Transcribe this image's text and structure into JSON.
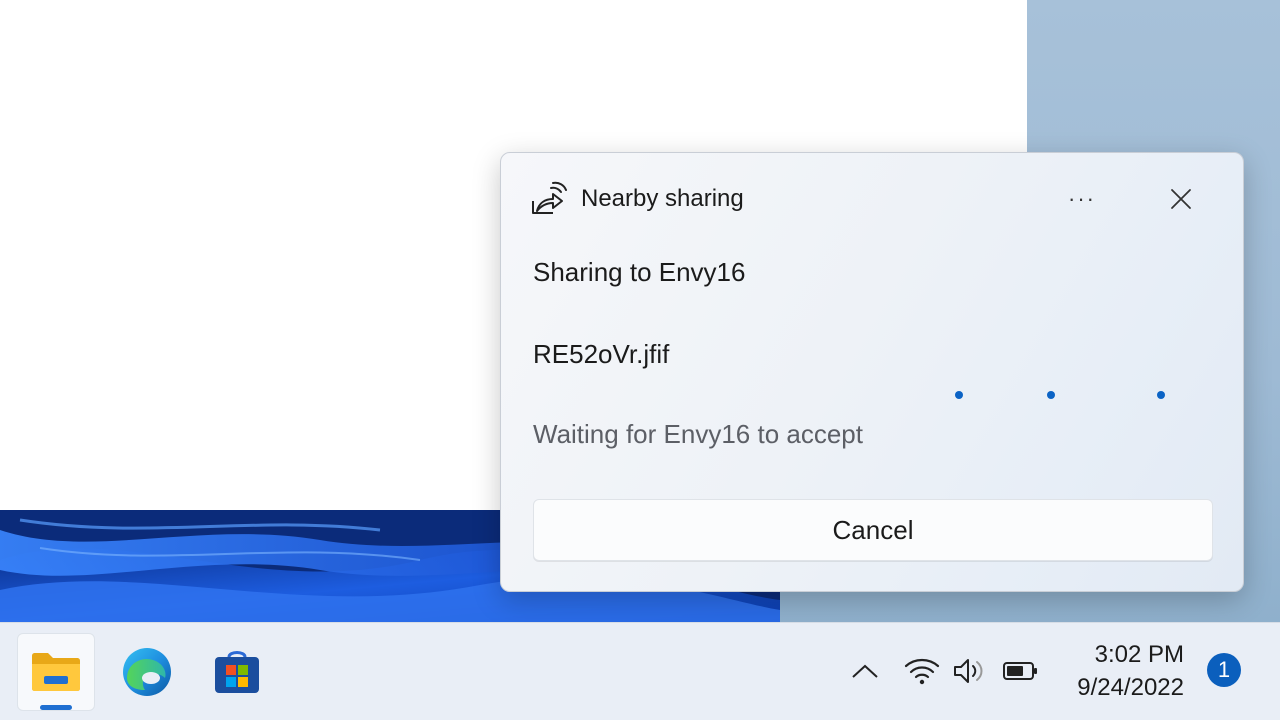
{
  "flyout": {
    "title": "Nearby sharing",
    "more_label": "···",
    "sharing_to": "Sharing to Envy16",
    "file_name": "RE52oVr.jfif",
    "status": "Waiting for Envy16 to accept",
    "cancel_label": "Cancel",
    "accent": "#0b63c5",
    "icon": "nearby-share-icon"
  },
  "taskbar": {
    "apps": [
      {
        "name": "File Explorer",
        "icon": "folder-icon",
        "active": true
      },
      {
        "name": "Microsoft Edge",
        "icon": "edge-icon",
        "active": false
      },
      {
        "name": "Microsoft Store",
        "icon": "store-icon",
        "active": false
      }
    ],
    "tray": {
      "icons": [
        "chevron-up-icon",
        "wifi-icon",
        "volume-icon",
        "battery-icon"
      ]
    },
    "clock": {
      "time": "3:02 PM",
      "date": "9/24/2022"
    },
    "notification_count": "1"
  }
}
